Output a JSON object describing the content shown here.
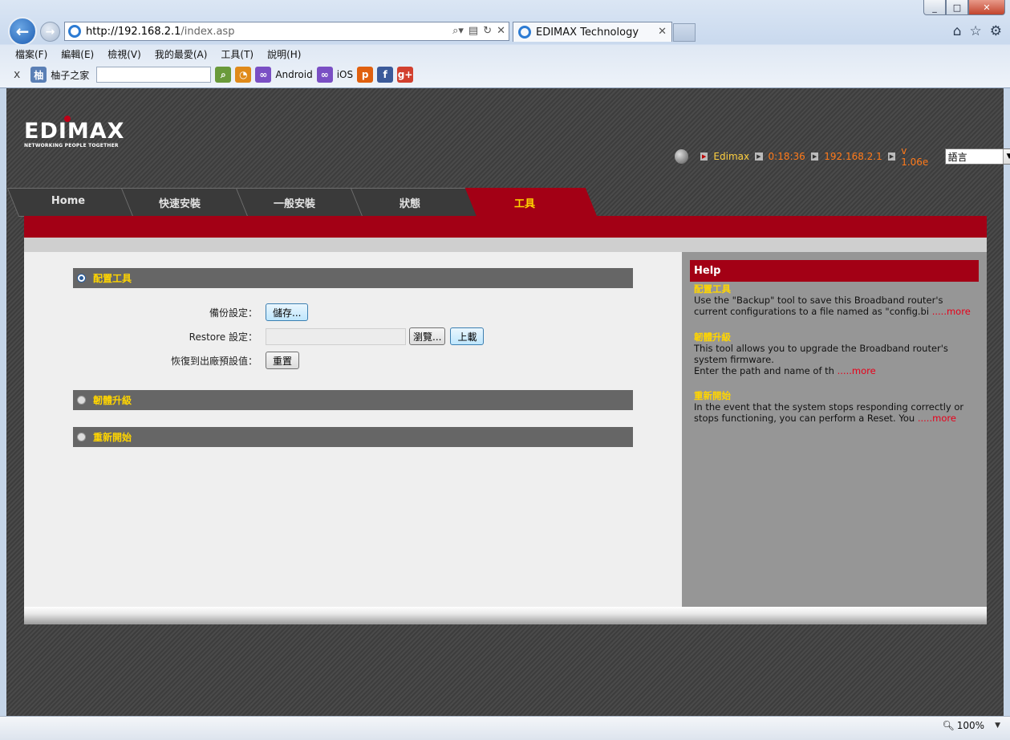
{
  "browser": {
    "address_host": "http://192.168.2.1",
    "address_path": "/index.asp",
    "tab_title": "EDIMAX Technology",
    "menu": [
      "檔案(F)",
      "編輯(E)",
      "檢視(V)",
      "我的最愛(A)",
      "工具(T)",
      "說明(H)"
    ],
    "favorites": {
      "site_name": "柚子之家",
      "search_value": "",
      "android_label": "Android",
      "ios_label": "iOS"
    },
    "zoom": "100%"
  },
  "router": {
    "brand": "EDIMAX",
    "tagline": "NETWORKING PEOPLE TOGETHER",
    "status": {
      "name": "Edimax",
      "uptime": "0:18:36",
      "ip": "192.168.2.1",
      "version": "v 1.06e"
    },
    "language_select": "語言",
    "nav": [
      "Home",
      "快速安裝",
      "一般安裝",
      "狀態",
      "工具"
    ],
    "active_nav": "工具",
    "colors": {
      "accent_red": "#a30015",
      "highlight_yellow": "#ffd500",
      "status_orange": "#ff7a1a"
    }
  },
  "config_tools": {
    "title": "配置工具",
    "backup_label": "備份設定：",
    "backup_button": "儲存...",
    "restore_label": "Restore 設定：",
    "browse_button": "瀏覽...",
    "upload_button": "上載",
    "reset_label": "恢復到出廠預設值：",
    "reset_button": "重置"
  },
  "firmware": {
    "title": "韌體升級"
  },
  "restart": {
    "title": "重新開始"
  },
  "help": {
    "title": "Help",
    "items": [
      {
        "heading": "配置工具",
        "text": "Use the \"Backup\" tool to save this Broadband router's current configurations to a file named as \"config.bi ",
        "more": ".....more"
      },
      {
        "heading": "韌體升級",
        "text": "This tool allows you to upgrade the Broadband router's system firmware.",
        "text2": "Enter the path and name of th ",
        "more": ".....more"
      },
      {
        "heading": "重新開始",
        "text": "In the event that the system stops responding correctly or stops functioning, you can perform a Reset. You ",
        "more": ".....more"
      }
    ]
  }
}
